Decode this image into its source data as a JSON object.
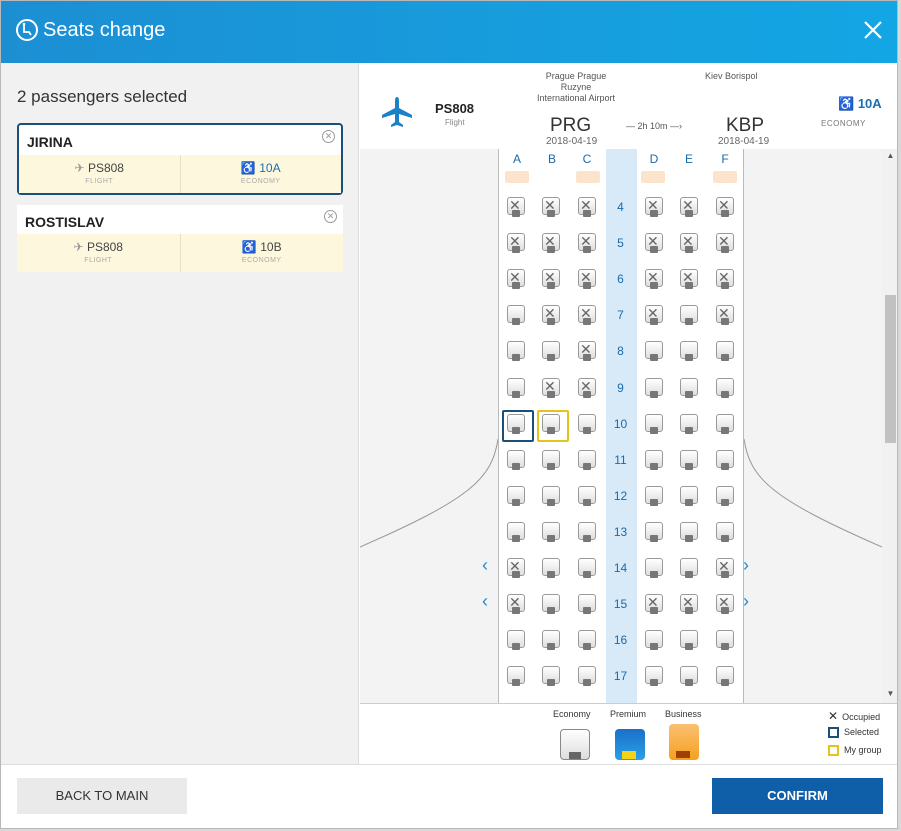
{
  "dialog": {
    "title": "Seats change"
  },
  "left": {
    "heading": "2 passengers selected",
    "passengers": [
      {
        "name": "JIRINA",
        "flight": "PS808",
        "flight_label": "FLIGHT",
        "seat": "10A",
        "class_label": "ECONOMY",
        "active": true
      },
      {
        "name": "ROSTISLAV",
        "flight": "PS808",
        "flight_label": "FLIGHT",
        "seat": "10B",
        "class_label": "ECONOMY",
        "active": false
      }
    ]
  },
  "flight": {
    "code": "PS808",
    "code_sub": "Flight",
    "origin_name": "Prague Prague Ruzyne International Airport",
    "origin_code": "PRG",
    "origin_date": "2018-04-19",
    "duration": "— 2h 10m —›",
    "dest_name": "Kiev Borispol",
    "dest_code": "KBP",
    "dest_date": "2018-04-19",
    "seat": "10A",
    "class_label": "ECONOMY"
  },
  "seatmap": {
    "columns": [
      "A",
      "B",
      "C",
      "D",
      "E",
      "F"
    ],
    "rows": [
      {
        "num": "4",
        "seats": [
          "occupied",
          "occupied",
          "occupied",
          "occupied",
          "occupied",
          "occupied"
        ]
      },
      {
        "num": "5",
        "seats": [
          "occupied",
          "occupied",
          "occupied",
          "occupied",
          "occupied",
          "occupied"
        ]
      },
      {
        "num": "6",
        "seats": [
          "occupied",
          "occupied",
          "occupied",
          "occupied",
          "occupied",
          "occupied"
        ]
      },
      {
        "num": "7",
        "seats": [
          "free",
          "occupied",
          "occupied",
          "occupied",
          "free",
          "occupied"
        ]
      },
      {
        "num": "8",
        "seats": [
          "free",
          "free",
          "occupied",
          "free",
          "free",
          "free"
        ]
      },
      {
        "num": "9",
        "seats": [
          "free",
          "occupied",
          "occupied",
          "free",
          "free",
          "free"
        ]
      },
      {
        "num": "10",
        "seats": [
          "selected",
          "mygroup",
          "free",
          "free",
          "free",
          "free"
        ]
      },
      {
        "num": "11",
        "seats": [
          "free",
          "free",
          "free",
          "free",
          "free",
          "free"
        ]
      },
      {
        "num": "12",
        "seats": [
          "free",
          "free",
          "free",
          "free",
          "free",
          "free"
        ]
      },
      {
        "num": "13",
        "seats": [
          "free",
          "free",
          "free",
          "free",
          "free",
          "free"
        ]
      },
      {
        "num": "14",
        "seats": [
          "occupied",
          "free",
          "free",
          "free",
          "free",
          "occupied"
        ],
        "exit": true
      },
      {
        "num": "15",
        "seats": [
          "occupied",
          "free",
          "free",
          "occupied",
          "occupied",
          "occupied"
        ],
        "exit": true
      },
      {
        "num": "16",
        "seats": [
          "free",
          "free",
          "free",
          "free",
          "free",
          "free"
        ]
      },
      {
        "num": "17",
        "seats": [
          "free",
          "free",
          "free",
          "free",
          "free",
          "free"
        ]
      }
    ]
  },
  "legend": {
    "economy": "Economy",
    "premium": "Premium",
    "business": "Business",
    "occupied": "Occupied",
    "selected": "Selected",
    "mygroup": "My group"
  },
  "footer": {
    "back": "BACK TO MAIN",
    "confirm": "CONFIRM"
  },
  "colors": {
    "brand": "#1c8fd3",
    "confirm": "#0f5fa8",
    "selected": "#1a4f7a",
    "mygroup": "#e6c319"
  }
}
